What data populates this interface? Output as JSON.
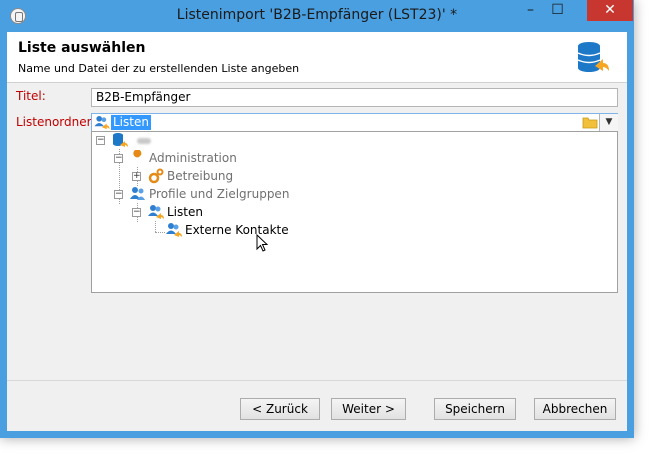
{
  "window": {
    "title": "Listenimport 'B2B-Empfänger (LST23)' *",
    "minimize_glyph": "–",
    "maximize_glyph": "☐",
    "close_glyph": "✕"
  },
  "header": {
    "title": "Liste auswählen",
    "subtitle": "Name und Datei der zu erstellenden Liste angeben",
    "icon": "database-folder-icon"
  },
  "form": {
    "titel_label": "Titel:",
    "titel_value": "B2B-Empfänger",
    "ordner_label": "Listenordner:",
    "ordner_value": "Listen"
  },
  "tree": {
    "items": [
      {
        "label": "",
        "icon": "database-icon",
        "expanded": true
      },
      {
        "label": "Administration",
        "icon": "wrench-icon",
        "expanded": true
      },
      {
        "label": "Betreibung",
        "icon": "gears-icon",
        "expanded": false
      },
      {
        "label": "Profile und Zielgruppen",
        "icon": "users-icon",
        "expanded": true
      },
      {
        "label": "Listen",
        "icon": "users-list-icon",
        "expanded": true
      },
      {
        "label": "Externe Kontakte",
        "icon": "users-list-icon",
        "expanded": false
      }
    ]
  },
  "buttons": {
    "back": "< Zurück",
    "next": "Weiter >",
    "save": "Speichern",
    "cancel": "Abbrechen"
  },
  "colors": {
    "titlebar": "#4a9fe0",
    "close": "#c7372f",
    "label_red": "#c00000",
    "selection": "#3399ff"
  }
}
